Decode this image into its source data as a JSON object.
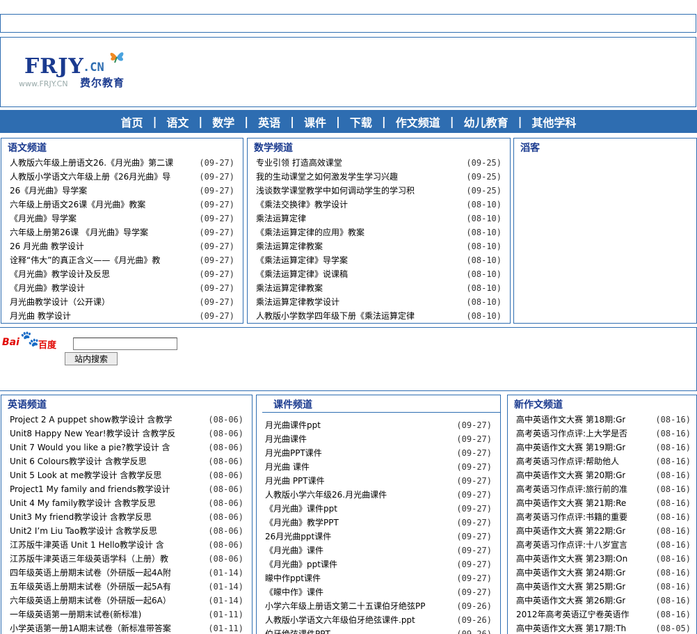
{
  "logo": {
    "main": "FRJY",
    "dotcn": ".CN",
    "cn_name": "费尔教育",
    "small": "www.FRJY.CN"
  },
  "nav": [
    "首页",
    "语文",
    "数学",
    "英语",
    "课件",
    "下载",
    "作文频道",
    "幼儿教育",
    "其他学科"
  ],
  "nav_sep": "|",
  "yuwen": {
    "title": "语文频道",
    "items": [
      {
        "t": "人教版六年级上册语文26.《月光曲》第二课",
        "d": "(09-27)"
      },
      {
        "t": "人教版小学语文六年级上册《26月光曲》导",
        "d": "(09-27)"
      },
      {
        "t": "26《月光曲》导学案",
        "d": "(09-27)"
      },
      {
        "t": "六年级上册语文26课《月光曲》教案",
        "d": "(09-27)"
      },
      {
        "t": "《月光曲》导学案",
        "d": "(09-27)"
      },
      {
        "t": "六年级上册第26课 《月光曲》导学案",
        "d": "(09-27)"
      },
      {
        "t": "26 月光曲 教学设计",
        "d": "(09-27)"
      },
      {
        "t": "诠释“伟大”的真正含义——《月光曲》教",
        "d": "(09-27)"
      },
      {
        "t": "《月光曲》教学设计及反思",
        "d": "(09-27)"
      },
      {
        "t": "《月光曲》教学设计",
        "d": "(09-27)"
      },
      {
        "t": "月光曲教学设计（公开课）",
        "d": "(09-27)"
      },
      {
        "t": "月光曲 教学设计",
        "d": "(09-27)"
      }
    ]
  },
  "shuxue": {
    "title": "数学频道",
    "items": [
      {
        "t": "专业引领 打造高效课堂",
        "d": "(09-25)"
      },
      {
        "t": "我的生动课堂之如何激发学生学习兴趣",
        "d": "(09-25)"
      },
      {
        "t": "浅谈数学课堂教学中如何调动学生的学习积",
        "d": "(09-25)"
      },
      {
        "t": "《乘法交换律》教学设计",
        "d": "(08-10)"
      },
      {
        "t": "乘法运算定律",
        "d": "(08-10)"
      },
      {
        "t": "《乘法运算定律的应用》教案",
        "d": "(08-10)"
      },
      {
        "t": "乘法运算定律教案",
        "d": "(08-10)"
      },
      {
        "t": "《乘法运算定律》导学案",
        "d": "(08-10)"
      },
      {
        "t": "《乘法运算定律》说课稿",
        "d": "(08-10)"
      },
      {
        "t": "乘法运算定律教案",
        "d": "(08-10)"
      },
      {
        "t": "乘法运算定律教学设计",
        "d": "(08-10)"
      },
      {
        "t": "人教版小学数学四年级下册《乘法运算定律",
        "d": "(08-10)"
      }
    ]
  },
  "xiaohu": {
    "title": "滔客"
  },
  "search": {
    "baidu_a": "Bai",
    "baidu_b": "百度",
    "input_value": "",
    "button_label": "站内搜索"
  },
  "yingyu": {
    "title": "英语频道",
    "items": [
      {
        "t": "Project 2 A puppet show教学设计 含教学",
        "d": "(08-06)"
      },
      {
        "t": "Unit8 Happy New Year!教学设计 含教学反",
        "d": "(08-06)"
      },
      {
        "t": "Unit 7 Would you like a pie?教学设计 含",
        "d": "(08-06)"
      },
      {
        "t": "Unit 6 Colours教学设计 含教学反思",
        "d": "(08-06)"
      },
      {
        "t": "Unit 5 Look at me教学设计 含教学反思",
        "d": "(08-06)"
      },
      {
        "t": "Project1 My family and friends教学设计",
        "d": "(08-06)"
      },
      {
        "t": "Unit 4 My family教学设计 含教学反思",
        "d": "(08-06)"
      },
      {
        "t": "Unit3 My friend教学设计 含教学反思",
        "d": "(08-06)"
      },
      {
        "t": "Unit2 I’m Liu Tao教学设计 含教学反思",
        "d": "(08-06)"
      },
      {
        "t": "江苏版牛津英语 Unit 1 Hello教学设计 含",
        "d": "(08-06)"
      },
      {
        "t": "江苏版牛津英语三年级英语学科（上册）教",
        "d": "(08-06)"
      },
      {
        "t": "四年级英语上册期末试卷（外研版一起4A附",
        "d": "(01-14)"
      },
      {
        "t": "五年级英语上册期末试卷（外研版一起5A有",
        "d": "(01-14)"
      },
      {
        "t": "六年级英语上册期末试卷（外研版一起6A）",
        "d": "(01-14)"
      },
      {
        "t": "一年级英语第一册期末试卷(新标准)",
        "d": "(01-11)"
      },
      {
        "t": "小学英语第一册1A期末试卷（新标准带答案",
        "d": "(01-11)"
      }
    ]
  },
  "kejian": {
    "title": "课件频道",
    "items": [
      {
        "t": "月光曲课件ppt",
        "d": "(09-27)"
      },
      {
        "t": "月光曲课件",
        "d": "(09-27)"
      },
      {
        "t": "月光曲PPT课件",
        "d": "(09-27)"
      },
      {
        "t": "月光曲 课件",
        "d": "(09-27)"
      },
      {
        "t": "月光曲 PPT课件",
        "d": "(09-27)"
      },
      {
        "t": "人教版小学六年级26.月光曲课件",
        "d": "(09-27)"
      },
      {
        "t": "《月光曲》课件ppt",
        "d": "(09-27)"
      },
      {
        "t": "《月光曲》教学PPT",
        "d": "(09-27)"
      },
      {
        "t": "26月光曲ppt课件",
        "d": "(09-27)"
      },
      {
        "t": "《月光曲》课件",
        "d": "(09-27)"
      },
      {
        "t": "《月光曲》ppt课件",
        "d": "(09-27)"
      },
      {
        "t": "矇中作ppt课件",
        "d": "(09-27)"
      },
      {
        "t": "《矇中作》课件",
        "d": "(09-27)"
      },
      {
        "t": "小学六年级上册语文第二十五课伯牙绝弦PP",
        "d": "(09-26)"
      },
      {
        "t": "人教版小学语文六年级伯牙绝弦课件.ppt",
        "d": "(09-26)"
      },
      {
        "t": "伯牙绝弦课件PPT",
        "d": "(09-26)"
      }
    ]
  },
  "zuowen": {
    "title": "新作文频道",
    "items": [
      {
        "t": "高中英语作文大赛 第18期:Gr",
        "d": "(08-16)"
      },
      {
        "t": "高考英语习作点评:上大学是否",
        "d": "(08-16)"
      },
      {
        "t": "高中英语作文大赛 第19期:Gr",
        "d": "(08-16)"
      },
      {
        "t": "高考英语习作点评:帮助他人",
        "d": "(08-16)"
      },
      {
        "t": "高中英语作文大赛 第20期:Gr",
        "d": "(08-16)"
      },
      {
        "t": "高考英语习作点评:旅行前的准",
        "d": "(08-16)"
      },
      {
        "t": "高中英语作文大赛 第21期:Re",
        "d": "(08-16)"
      },
      {
        "t": "高考英语习作点评:书籍的重要",
        "d": "(08-16)"
      },
      {
        "t": "高中英语作文大赛 第22期:Gr",
        "d": "(08-16)"
      },
      {
        "t": "高考英语习作点评:十八岁宣言",
        "d": "(08-16)"
      },
      {
        "t": "高中英语作文大赛 第23期:On",
        "d": "(08-16)"
      },
      {
        "t": "高中英语作文大赛 第24期:Gr",
        "d": "(08-16)"
      },
      {
        "t": "高中英语作文大赛 第25期:Gr",
        "d": "(08-16)"
      },
      {
        "t": "高中英语作文大赛 第26期:Gr",
        "d": "(08-16)"
      },
      {
        "t": "2012年高考英语辽宁卷英语作",
        "d": "(08-16)"
      },
      {
        "t": "高中英语作文大赛 第17期:Th",
        "d": "(08-05)"
      }
    ]
  }
}
